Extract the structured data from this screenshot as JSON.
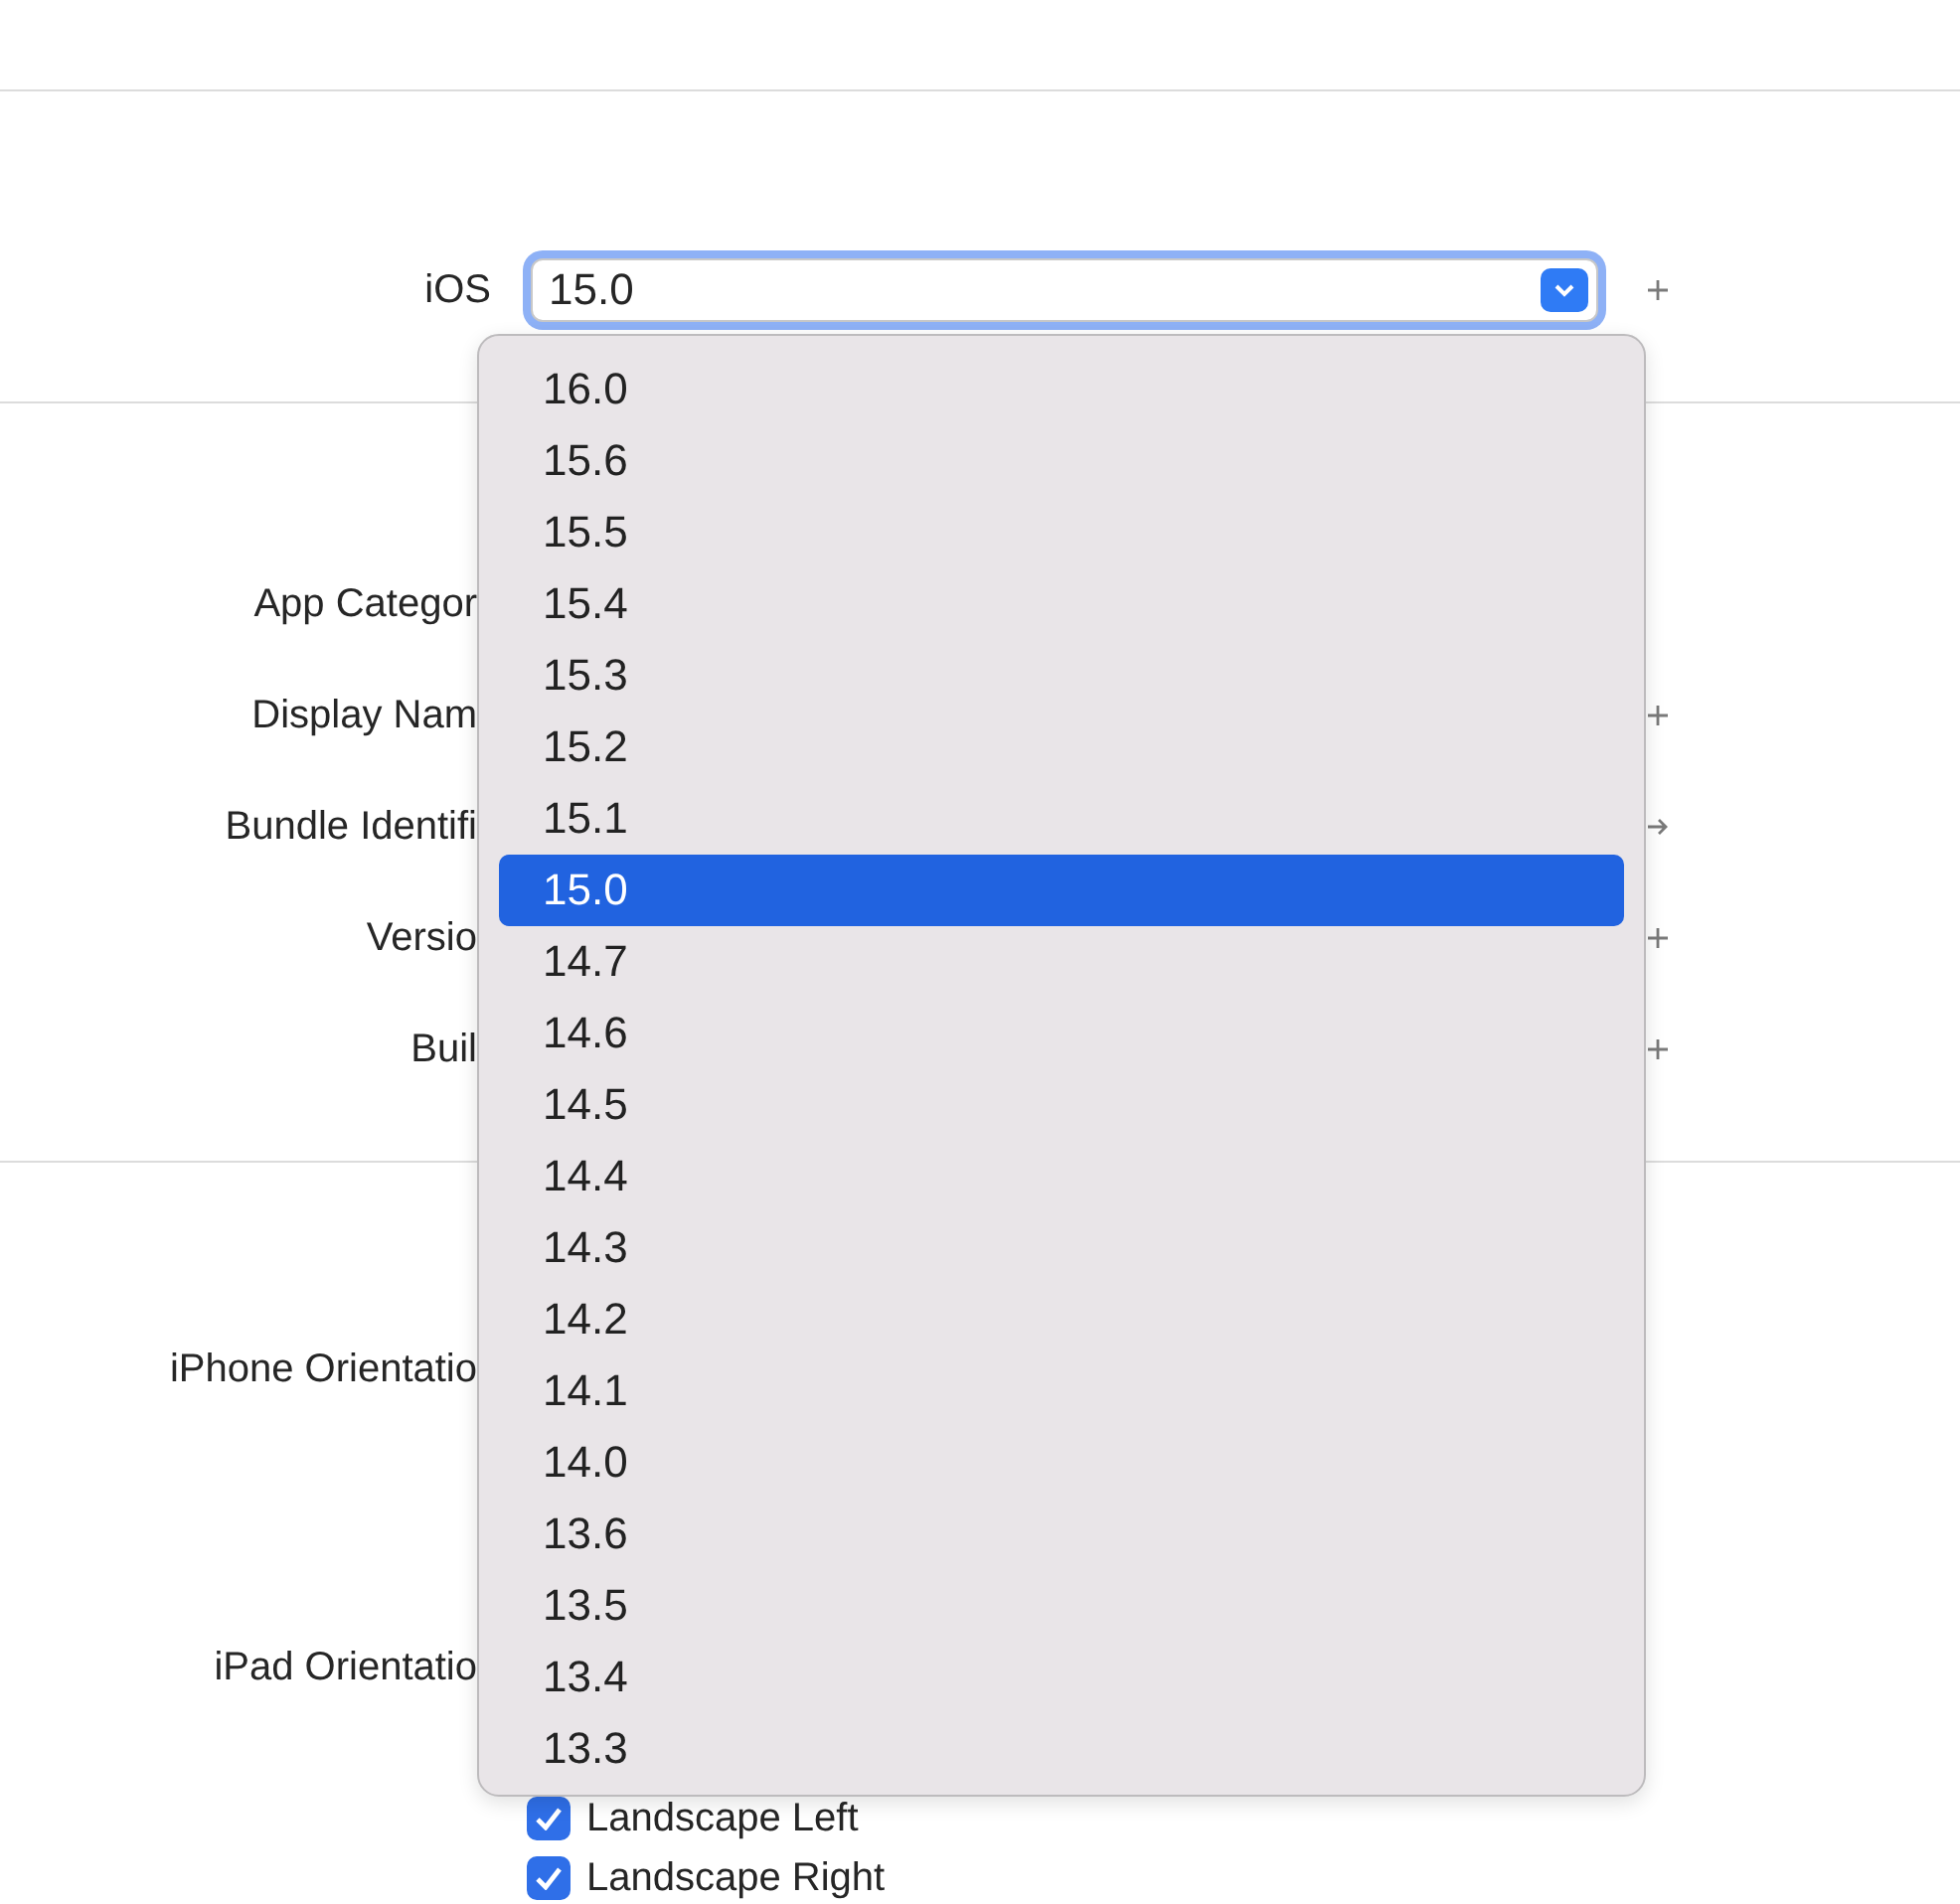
{
  "deployment": {
    "label": "iOS",
    "value": "15.0",
    "trailing": {
      "kind": "plus"
    }
  },
  "identity": [
    {
      "label": "App Categor"
    },
    {
      "label": "Display Nam",
      "trailing": {
        "kind": "plus"
      }
    },
    {
      "label": "Bundle Identifi",
      "trailing": {
        "kind": "arrow"
      }
    },
    {
      "label": "Versio",
      "trailing": {
        "kind": "plus"
      }
    },
    {
      "label": "Buil",
      "trailing": {
        "kind": "plus"
      }
    }
  ],
  "orientation": {
    "iphone_label": "iPhone Orientatio",
    "ipad_label": "iPad Orientatio",
    "ipad_options": [
      {
        "label": "Landscape Left",
        "checked": true
      },
      {
        "label": "Landscape Right",
        "checked": true
      }
    ]
  },
  "version_menu": [
    {
      "label": "16.0",
      "selected": false
    },
    {
      "label": "15.6",
      "selected": false
    },
    {
      "label": "15.5",
      "selected": false
    },
    {
      "label": "15.4",
      "selected": false
    },
    {
      "label": "15.3",
      "selected": false
    },
    {
      "label": "15.2",
      "selected": false
    },
    {
      "label": "15.1",
      "selected": false
    },
    {
      "label": "15.0",
      "selected": true
    },
    {
      "label": "14.7",
      "selected": false
    },
    {
      "label": "14.6",
      "selected": false
    },
    {
      "label": "14.5",
      "selected": false
    },
    {
      "label": "14.4",
      "selected": false
    },
    {
      "label": "14.3",
      "selected": false
    },
    {
      "label": "14.2",
      "selected": false
    },
    {
      "label": "14.1",
      "selected": false
    },
    {
      "label": "14.0",
      "selected": false
    },
    {
      "label": "13.6",
      "selected": false
    },
    {
      "label": "13.5",
      "selected": false
    },
    {
      "label": "13.4",
      "selected": false
    },
    {
      "label": "13.3",
      "selected": false
    }
  ]
}
